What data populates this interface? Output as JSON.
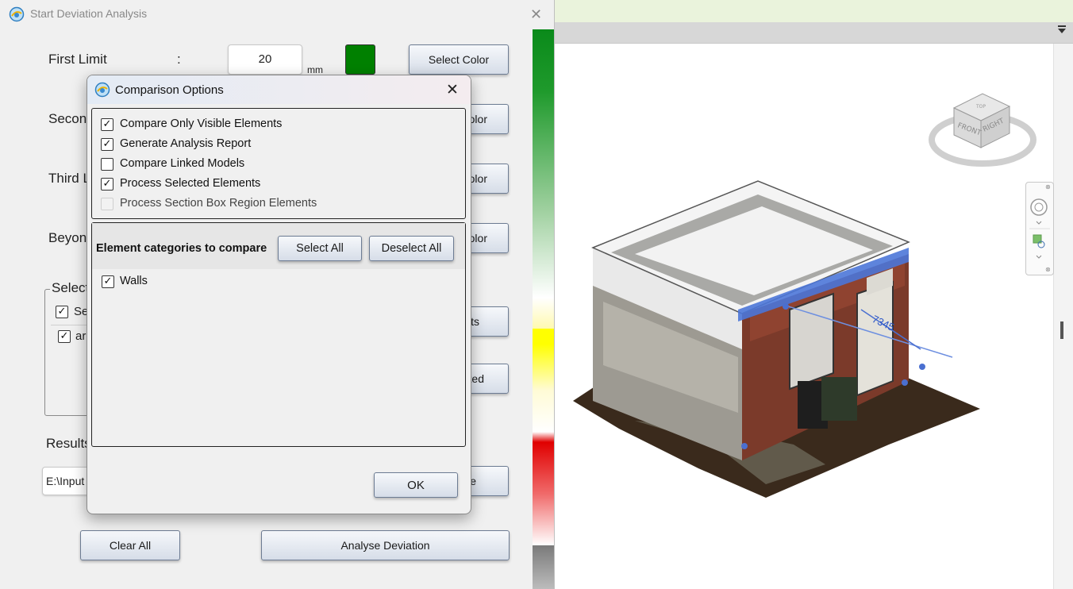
{
  "main_dialog": {
    "title": "Start Deviation Analysis",
    "first_limit": {
      "label": "First Limit",
      "colon": ":",
      "value": "20",
      "unit": "mm",
      "color": "#008000",
      "select_color_label": "Select Color"
    },
    "second_limit_label": "Secon",
    "third_limit_label": "Third L",
    "beyond_label": "Beyon",
    "partial_button_labels": [
      "olor",
      "olor",
      "olor"
    ],
    "selection_group": {
      "title": "Select",
      "items": [
        {
          "label": "Se",
          "checked": true
        },
        {
          "label": "ar",
          "checked": true
        }
      ]
    },
    "partial_button_labels_2": [
      "ts",
      "cted"
    ],
    "results_label": "Results",
    "results_path": "E:\\Input",
    "browse_partial": "e",
    "clear_all_label": "Clear All",
    "analyse_label": "Analyse Deviation",
    "gradient_colors": [
      "#0a8a1a",
      "#ffff00",
      "#e00000"
    ]
  },
  "options_dialog": {
    "title": "Comparison Options",
    "close_glyph": "✕",
    "options": [
      {
        "label": "Compare Only Visible Elements",
        "checked": true,
        "enabled": true
      },
      {
        "label": "Generate Analysis Report",
        "checked": true,
        "enabled": true
      },
      {
        "label": "Compare Linked Models",
        "checked": false,
        "enabled": true
      },
      {
        "label": "Process Selected Elements",
        "checked": true,
        "enabled": true
      },
      {
        "label": "Process Section Box Region Elements",
        "checked": false,
        "enabled": false
      }
    ],
    "categories_title": "Element categories to compare",
    "select_all_label": "Select All",
    "deselect_all_label": "Deselect All",
    "categories": [
      {
        "label": "Walls",
        "checked": true
      }
    ],
    "ok_label": "OK"
  },
  "viewport": {
    "viewcube": {
      "front_label": "FRONT",
      "right_label": "RIGHT",
      "top_label": "TOP"
    },
    "dimension_text": "7345"
  }
}
